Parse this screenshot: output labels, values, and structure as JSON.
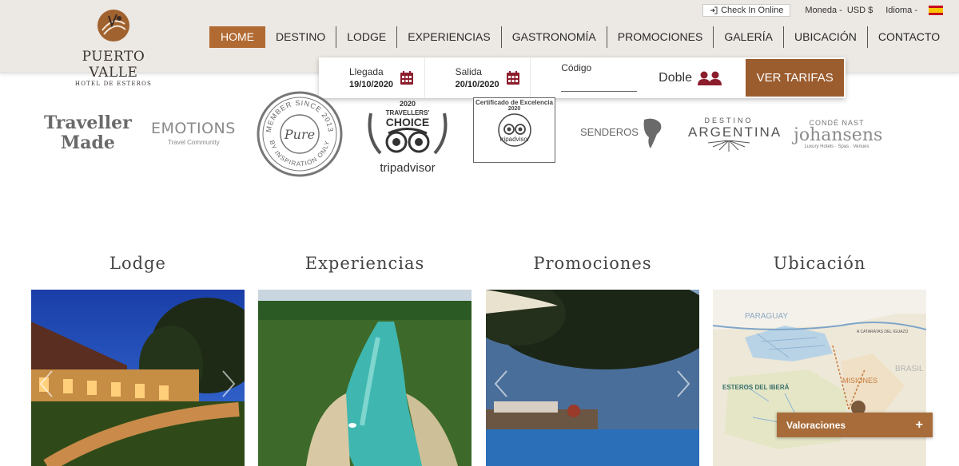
{
  "logo": {
    "name": "PUERTO VALLE",
    "subtitle": "HOTEL DE ESTEROS"
  },
  "topbar": {
    "checkin_label": "Check In Online",
    "currency_label": "Moneda -",
    "currency_value": "USD $",
    "language_label": "Idioma -"
  },
  "nav": {
    "items": [
      "HOME",
      "DESTINO",
      "LODGE",
      "EXPERIENCIAS",
      "GASTRONOMÍA",
      "PROMOCIONES",
      "GALERÍA",
      "UBICACIÓN",
      "CONTACTO"
    ],
    "active": "HOME"
  },
  "booking": {
    "arrival_label": "Llegada",
    "arrival_value": "19/10/2020",
    "departure_label": "Salida",
    "departure_value": "20/10/2020",
    "code_label": "Código",
    "code_value": "",
    "room_value": "Doble",
    "submit_label": "VER TARIFAS"
  },
  "awards": {
    "traveller_made_1": "Traveller",
    "traveller_made_2": "Made",
    "emotions": "EMOTIONS",
    "emotions_sub": "Travel Community",
    "pure_top": "MEMBER SINCE 2013",
    "pure_bottom": "BY INSPIRATION ONLY",
    "pure_center": "Pure",
    "ta_choice_year": "2020",
    "ta_choice_line1": "TRAVELLERS'",
    "ta_choice_line2": "CHOICE",
    "ta_choice_brand": "tripadvisor",
    "ta_cert_title": "Certificado de Excelencia",
    "ta_cert_year": "2020",
    "ta_cert_brand": "tripadvisor",
    "senderos": "SENDEROS",
    "argentina_top": "DESTINO",
    "argentina_main": "ARGENTINA",
    "conde_top": "CONDÉ NAST",
    "conde_main": "johansens",
    "conde_sub": "Luxury Hotels · Spas · Venues"
  },
  "sections": [
    "Lodge",
    "Experiencias",
    "Promociones",
    "Ubicación"
  ],
  "map_labels": {
    "paraguay": "PARAGUAY",
    "esteros": "ESTEROS DEL IBERÁ",
    "misiones": "MISIONES",
    "brasil": "BRASIL",
    "cataratas": "A CATARATAS DEL IGUAZÚ"
  },
  "valoraciones": {
    "label": "Valoraciones",
    "toggle": "+"
  },
  "colors": {
    "accent": "#b06a32",
    "button": "#9b5c2e",
    "header_bg": "#ece8e3",
    "icon_red": "#8b1d2c"
  }
}
